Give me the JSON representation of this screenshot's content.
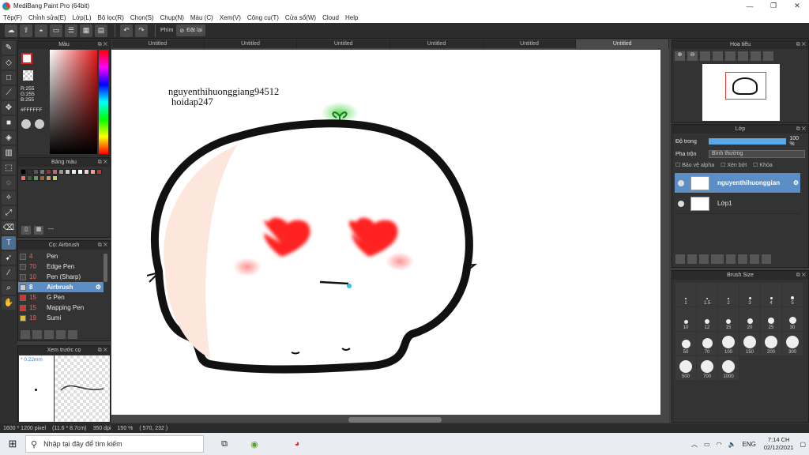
{
  "window": {
    "title": "MediBang Paint Pro (64bit)",
    "controls": [
      "—",
      "❐",
      "✕"
    ]
  },
  "menu": [
    "Tệp(F)",
    "Chỉnh sửa(E)",
    "Lớp(L)",
    "Bộ lọc(R)",
    "Chọn(S)",
    "Chụp(N)",
    "Màu (C)",
    "Xem(V)",
    "Công cụ(T)",
    "Cửa sổ(W)",
    "Cloud",
    "Help"
  ],
  "toolbar": {
    "phim_label": "Phím",
    "reset_label": "Đặt lại"
  },
  "tabs": [
    "Untitled",
    "Untitled",
    "Untitled",
    "Untitled",
    "Untitled",
    "Untitled"
  ],
  "panels": {
    "color": {
      "title": "Màu",
      "r": "R:255",
      "g": "G:255",
      "b": "B:255",
      "hex": "#FFFFFF"
    },
    "palette": {
      "title": "Bảng màu",
      "dashes": "---"
    },
    "brush": {
      "title": "Cọ: Airbrush"
    },
    "preview": {
      "title": "Xem trước cọ",
      "size": "* 0.22mm"
    },
    "navigator": {
      "title": "Hoa tiêu"
    },
    "layers": {
      "title": "Lớp",
      "opacity_label": "Độ trong",
      "opacity_value": "100 %",
      "opacity": 1.0,
      "blend_label": "Pha trộn",
      "blend_value": "Bình thường",
      "protect_alpha": "Bảo vệ alpha",
      "clipping": "Xén bớt",
      "lock": "Khóa",
      "items": [
        {
          "name": "nguyenthihuonggian",
          "selected": true
        },
        {
          "name": "Lớp1",
          "selected": false
        }
      ]
    },
    "brush_size": {
      "title": "Brush Size",
      "sizes": [
        "1",
        "1.5",
        "2",
        "3",
        "4",
        "5",
        "10",
        "12",
        "15",
        "20",
        "25",
        "30",
        "50",
        "70",
        "100",
        "150",
        "200",
        "300",
        "500",
        "700",
        "1000"
      ]
    }
  },
  "brushes": [
    {
      "num": "4",
      "name": "Pen",
      "color": "#444444",
      "selected": false
    },
    {
      "num": "70",
      "name": "Edge Pen",
      "color": "#444444",
      "selected": false
    },
    {
      "num": "10",
      "name": "Pen (Sharp)",
      "color": "#444444",
      "selected": false
    },
    {
      "num": "8",
      "name": "Airbrush",
      "color": "#cccccc",
      "selected": true
    },
    {
      "num": "15",
      "name": "G Pen",
      "color": "#e03030",
      "selected": false
    },
    {
      "num": "15",
      "name": "Mapping Pen",
      "color": "#e03030",
      "selected": false
    },
    {
      "num": "19",
      "name": "Sumi",
      "color": "#e0c030",
      "selected": false
    }
  ],
  "palette_colors": [
    "#000000",
    "#333333",
    "#555555",
    "#777777",
    "#993333",
    "#cc6666",
    "#999999",
    "#cccccc",
    "#eeeeee",
    "#ffffff",
    "#ffcccc",
    "#ff9999",
    "#cc3333",
    "#ff6666",
    "#336633",
    "#669966",
    "#996633",
    "#cc9966",
    "#cccc66"
  ],
  "canvas": {
    "text1": "nguyenthihuonggiang94512",
    "text2": "hoidap247"
  },
  "status": {
    "size": "1600 * 1200 pixel",
    "cm": "(11.6 * 8.7cm)",
    "dpi": "350 dpi",
    "zoom": "150 %",
    "pos": "( 570, 232 )"
  },
  "taskbar": {
    "search": "Nhập tại đây để tìm kiếm",
    "lang": "ENG",
    "time": "7:14 CH",
    "date": "02/12/2021"
  }
}
